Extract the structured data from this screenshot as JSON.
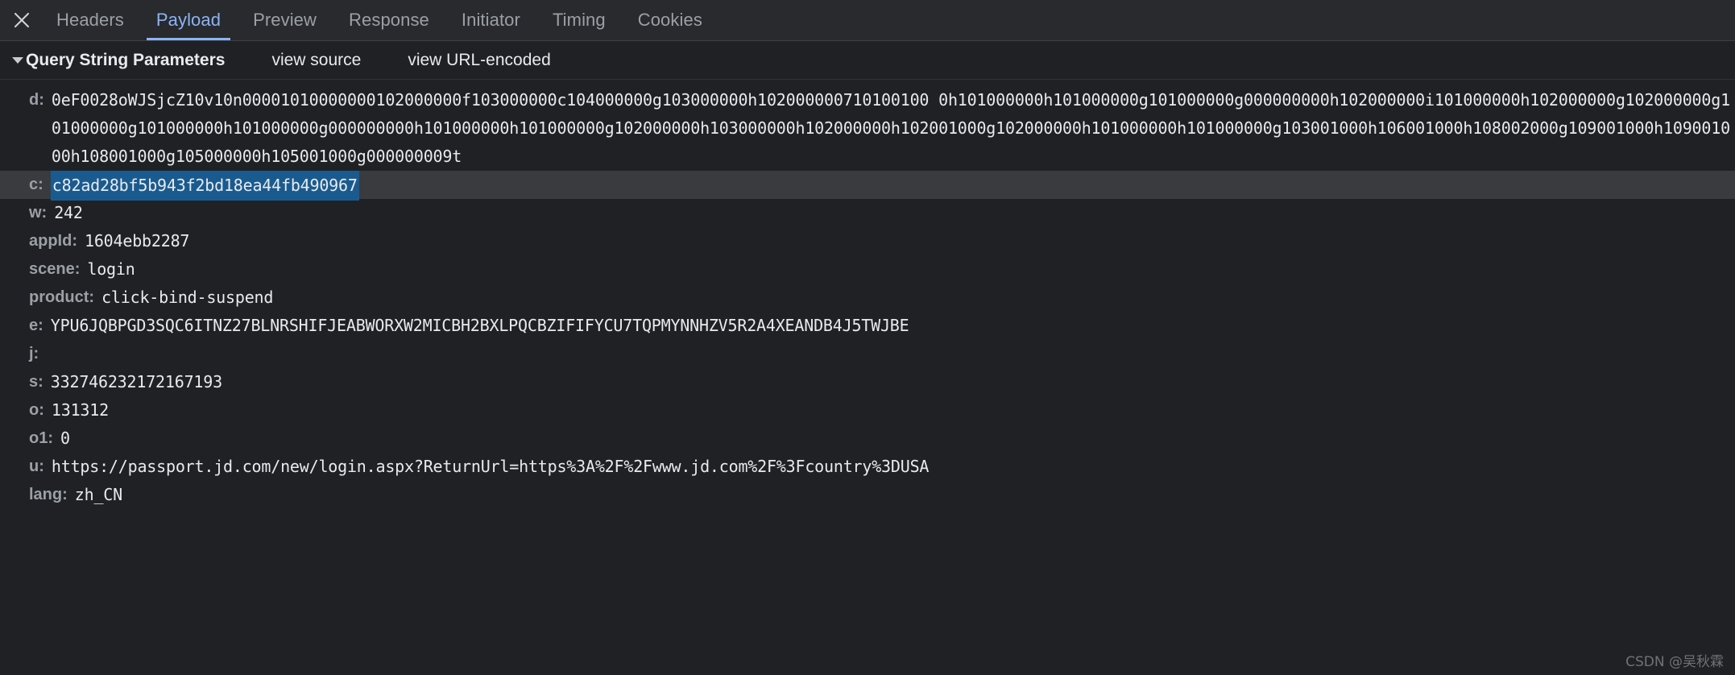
{
  "panel": {
    "close_icon": "close-icon",
    "tabs": [
      {
        "label": "Headers",
        "active": false
      },
      {
        "label": "Payload",
        "active": true
      },
      {
        "label": "Preview",
        "active": false
      },
      {
        "label": "Response",
        "active": false
      },
      {
        "label": "Initiator",
        "active": false
      },
      {
        "label": "Timing",
        "active": false
      },
      {
        "label": "Cookies",
        "active": false
      }
    ],
    "active_tab": "Payload",
    "accent_color": "#8ab4f8",
    "background_color": "#202124",
    "tabbar_color": "#292a2d",
    "selection_color": "#1a5b8f"
  },
  "section": {
    "title": "Query String Parameters",
    "expanded": true,
    "disclosure_icon": "triangle-down-icon",
    "view_source_label": "view source",
    "view_url_encoded_label": "view URL-encoded"
  },
  "parameters": [
    {
      "key": "d:",
      "value": "0eF0028oWJSjcZ10v10n00001010000000102000000f103000000c104000000g103000000h102000000710100100 0h101000000h101000000g101000000g000000000h102000000i101000000h102000000g102000000g101000000g101000000h101000000g000000000h101000000h101000000g102000000h103000000h102000000h102001000g102000000h101000000h101000000g103001000h106001000h108002000g109001000h109001000h108001000g105000000h105001000g000000009t",
      "selected": false,
      "multiline": true
    },
    {
      "key": "c:",
      "value": "c82ad28bf5b943f2bd18ea44fb490967",
      "selected": true,
      "multiline": false
    },
    {
      "key": "w:",
      "value": "242",
      "selected": false,
      "multiline": false
    },
    {
      "key": "appId:",
      "value": "1604ebb2287",
      "selected": false,
      "multiline": false
    },
    {
      "key": "scene:",
      "value": "login",
      "selected": false,
      "multiline": false
    },
    {
      "key": "product:",
      "value": "click-bind-suspend",
      "selected": false,
      "multiline": false
    },
    {
      "key": "e:",
      "value": "YPU6JQBPGD3SQC6ITNZ27BLNRSHIFJEABWORXW2MICBH2BXLPQCBZIFIFYCU7TQPMYNNHZV5R2A4XEANDB4J5TWJBE",
      "selected": false,
      "multiline": false
    },
    {
      "key": "j:",
      "value": "",
      "selected": false,
      "multiline": false
    },
    {
      "key": "s:",
      "value": "332746232172167193",
      "selected": false,
      "multiline": false
    },
    {
      "key": "o:",
      "value": "131312",
      "selected": false,
      "multiline": false
    },
    {
      "key": "o1:",
      "value": "0",
      "selected": false,
      "multiline": false
    },
    {
      "key": "u:",
      "value": "https://passport.jd.com/new/login.aspx?ReturnUrl=https%3A%2F%2Fwww.jd.com%2F%3Fcountry%3DUSA",
      "selected": false,
      "multiline": false
    },
    {
      "key": "lang:",
      "value": "zh_CN",
      "selected": false,
      "multiline": false
    }
  ],
  "watermark": {
    "text": "CSDN @吴秋霖"
  }
}
